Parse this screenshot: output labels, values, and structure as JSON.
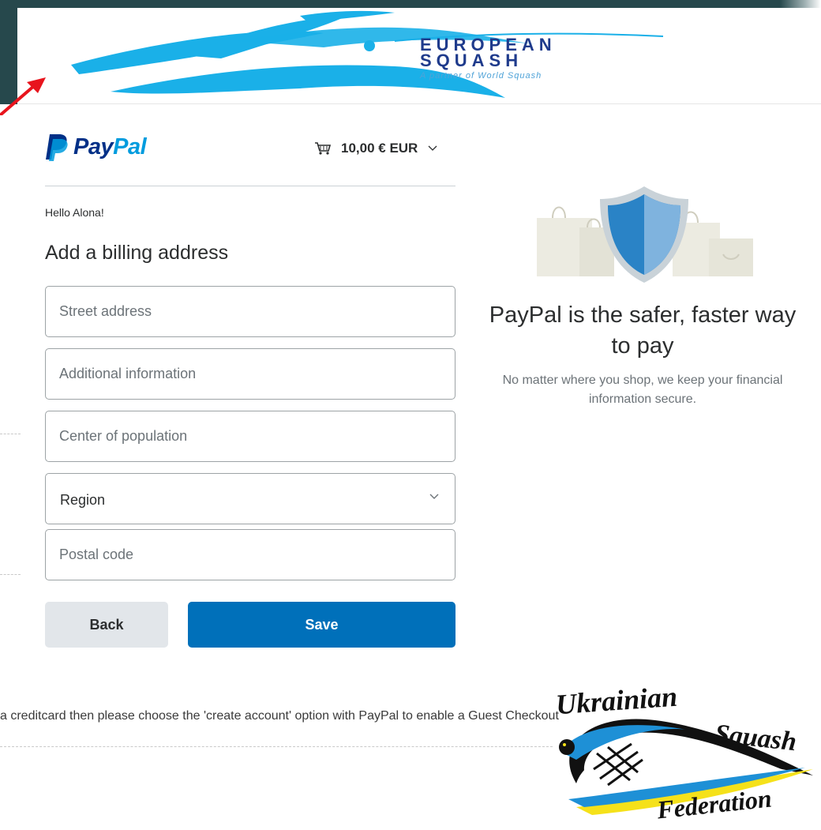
{
  "banner": {
    "logo_line1": "EUROPEAN",
    "logo_line2": "SQUASH",
    "logo_tagline": "A partner of World Squash",
    "arrow_color": "#e8141d",
    "brand_color": "#1f3b8c",
    "swoosh_color": "#1ab0e8"
  },
  "paypal": {
    "logo_pay": "Pay",
    "logo_pal": "Pal",
    "cart_icon": "shopping-cart-icon",
    "cart_amount": "10,00 € EUR",
    "greeting": "Hello Alona!",
    "form_title": "Add a billing address",
    "fields": {
      "street_placeholder": "Street address",
      "additional_placeholder": "Additional information",
      "city_placeholder": "Center of population",
      "region_value": "Region",
      "postal_placeholder": "Postal code"
    },
    "buttons": {
      "back_label": "Back",
      "save_label": "Save"
    },
    "colors": {
      "primary": "#0070ba",
      "logo_dark": "#003087",
      "logo_light": "#009cde"
    }
  },
  "promo": {
    "title": "PayPal is the safer, faster way to pay",
    "subtitle": "No matter where you shop, we keep your financial information secure."
  },
  "slide": {
    "note": "a creditcard then please choose the 'create account' option with PayPal to enable a Guest Checkout"
  },
  "federation_logo": {
    "word1": "Ukrainian",
    "word2": "Squash",
    "word3": "Federation",
    "colors": [
      "#1e90d6",
      "#f5e11a",
      "#111111"
    ]
  }
}
